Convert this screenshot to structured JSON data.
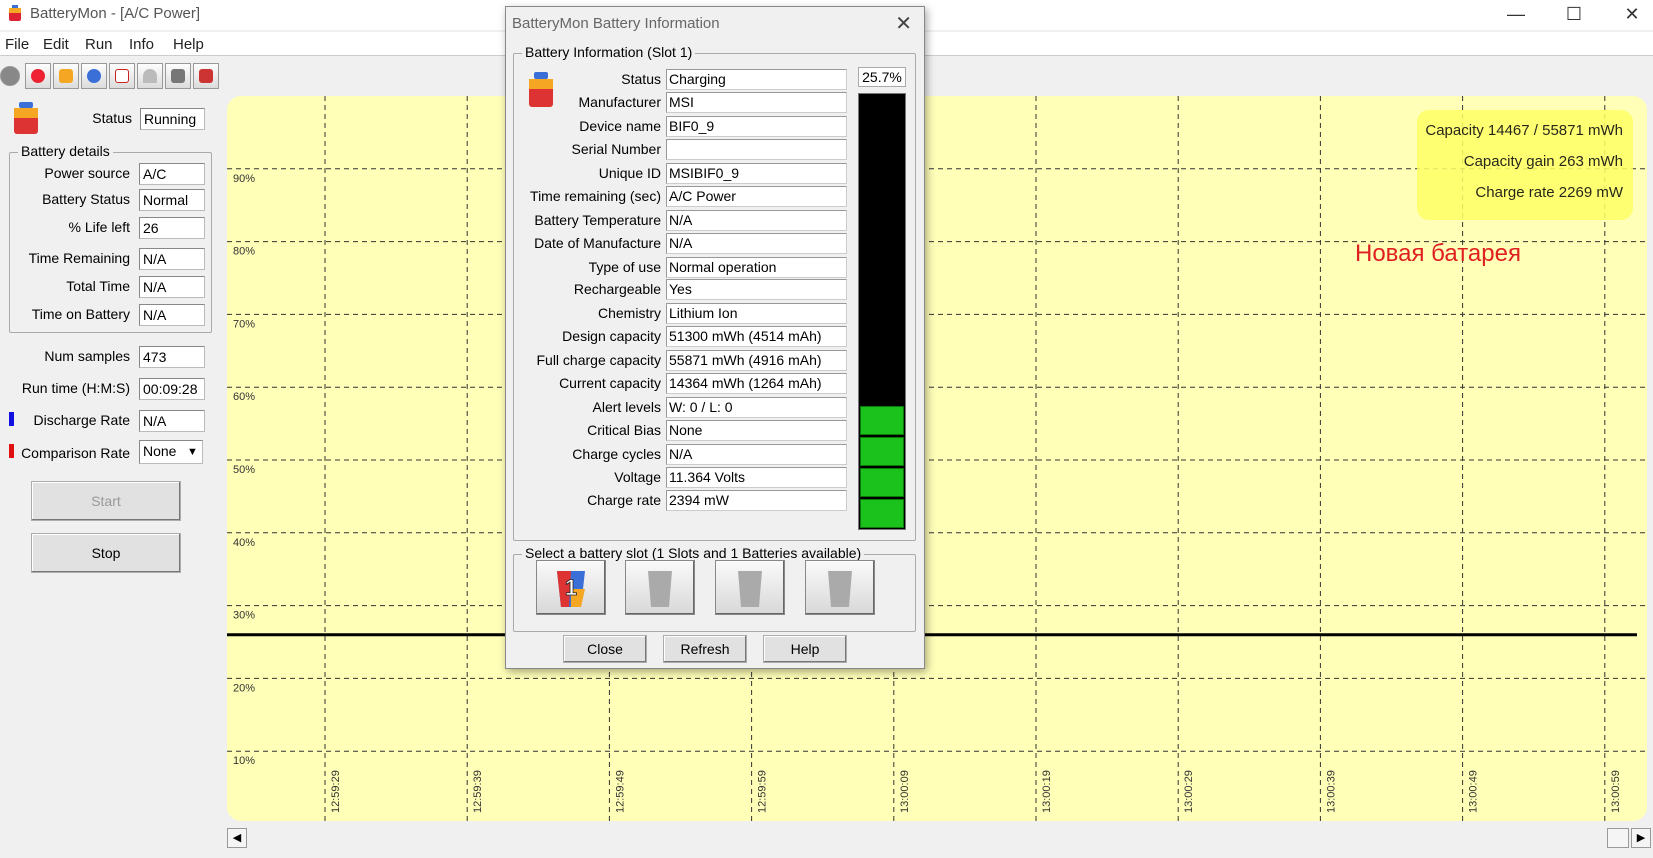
{
  "window": {
    "title": "BatteryMon - [A/C Power]",
    "minimize": "—",
    "maximize": "☐",
    "close": "✕"
  },
  "menu": [
    "File",
    "Edit",
    "Run",
    "Info",
    "Help"
  ],
  "toolbar_icons": [
    "record-icon",
    "stop-icon",
    "battery-icon",
    "settings-icon",
    "checklist-icon",
    "gauge-icon",
    "pointer-icon",
    "network-icon"
  ],
  "left_panel": {
    "status_label": "Status",
    "status_value": "Running",
    "battery_details_title": "Battery details",
    "details": [
      {
        "label": "Power source",
        "value": "A/C"
      },
      {
        "label": "Battery Status",
        "value": "Normal"
      },
      {
        "label": "% Life left",
        "value": "26"
      },
      {
        "label": "Time Remaining",
        "value": "N/A"
      },
      {
        "label": "Total Time",
        "value": "N/A"
      },
      {
        "label": "Time on Battery",
        "value": "N/A"
      }
    ],
    "num_samples_label": "Num samples",
    "num_samples": "473",
    "run_time_label": "Run time (H:M:S)",
    "run_time": "00:09:28",
    "discharge_rate_label": "Discharge Rate",
    "discharge_rate": "N/A",
    "comparison_rate_label": "Comparison Rate",
    "comparison_rate": "None",
    "start_label": "Start",
    "stop_label": "Stop",
    "discharge_color": "#1010e0",
    "comparison_color": "#e01010"
  },
  "chart_data": {
    "type": "line",
    "ylim": [
      0,
      100
    ],
    "y_ticks": [
      "10%",
      "20%",
      "30%",
      "40%",
      "50%",
      "60%",
      "70%",
      "80%",
      "90%"
    ],
    "x_ticks": [
      "12:59:29",
      "12:59:39",
      "12:59:49",
      "12:59:59",
      "13:00:09",
      "13:00:19",
      "13:00:29",
      "13:00:39",
      "13:00:49",
      "13:00:59"
    ],
    "series": [
      {
        "values": [
          26,
          26,
          26,
          26,
          26,
          26,
          26,
          26,
          26,
          26
        ],
        "color": "#000000"
      }
    ],
    "grid": true,
    "background": "#ffffb8"
  },
  "info_box": {
    "capacity": "Capacity 14467 / 55871 mWh",
    "capacity_gain": "Capacity gain 263 mWh",
    "charge_rate": "Charge rate 2269 mW"
  },
  "annotation": "Новая батарея",
  "dialog": {
    "title": "BatteryMon Battery Information",
    "group_title": "Battery Information (Slot 1)",
    "percent": "25.7%",
    "level_fraction": 0.257,
    "fields": [
      {
        "label": "Status",
        "value": "Charging"
      },
      {
        "label": "Manufacturer",
        "value": "MSI"
      },
      {
        "label": "Device name",
        "value": "BIF0_9"
      },
      {
        "label": "Serial Number",
        "value": ""
      },
      {
        "label": "Unique ID",
        "value": "MSIBIF0_9"
      },
      {
        "label": "Time remaining (sec)",
        "value": "A/C Power"
      },
      {
        "label": "Battery Temperature",
        "value": "N/A"
      },
      {
        "label": "Date of Manufacture",
        "value": "N/A"
      },
      {
        "label": "Type of use",
        "value": "Normal operation"
      },
      {
        "label": "Rechargeable",
        "value": "Yes"
      },
      {
        "label": "Chemistry",
        "value": "Lithium Ion"
      },
      {
        "label": "Design capacity",
        "value": "51300 mWh (4514 mAh)"
      },
      {
        "label": "Full charge capacity",
        "value": "55871 mWh (4916 mAh)"
      },
      {
        "label": "Current capacity",
        "value": "14364 mWh (1264 mAh)"
      },
      {
        "label": "Alert levels",
        "value": "W: 0 / L: 0"
      },
      {
        "label": "Critical Bias",
        "value": "None"
      },
      {
        "label": "Charge cycles",
        "value": "N/A"
      },
      {
        "label": "Voltage",
        "value": "11.364 Volts"
      },
      {
        "label": "Charge rate",
        "value": "2394 mW"
      }
    ],
    "slot_group_title": "Select a battery slot (1 Slots and 1 Batteries available)",
    "slot1_label": "1",
    "close_label": "Close",
    "refresh_label": "Refresh",
    "help_label": "Help"
  }
}
